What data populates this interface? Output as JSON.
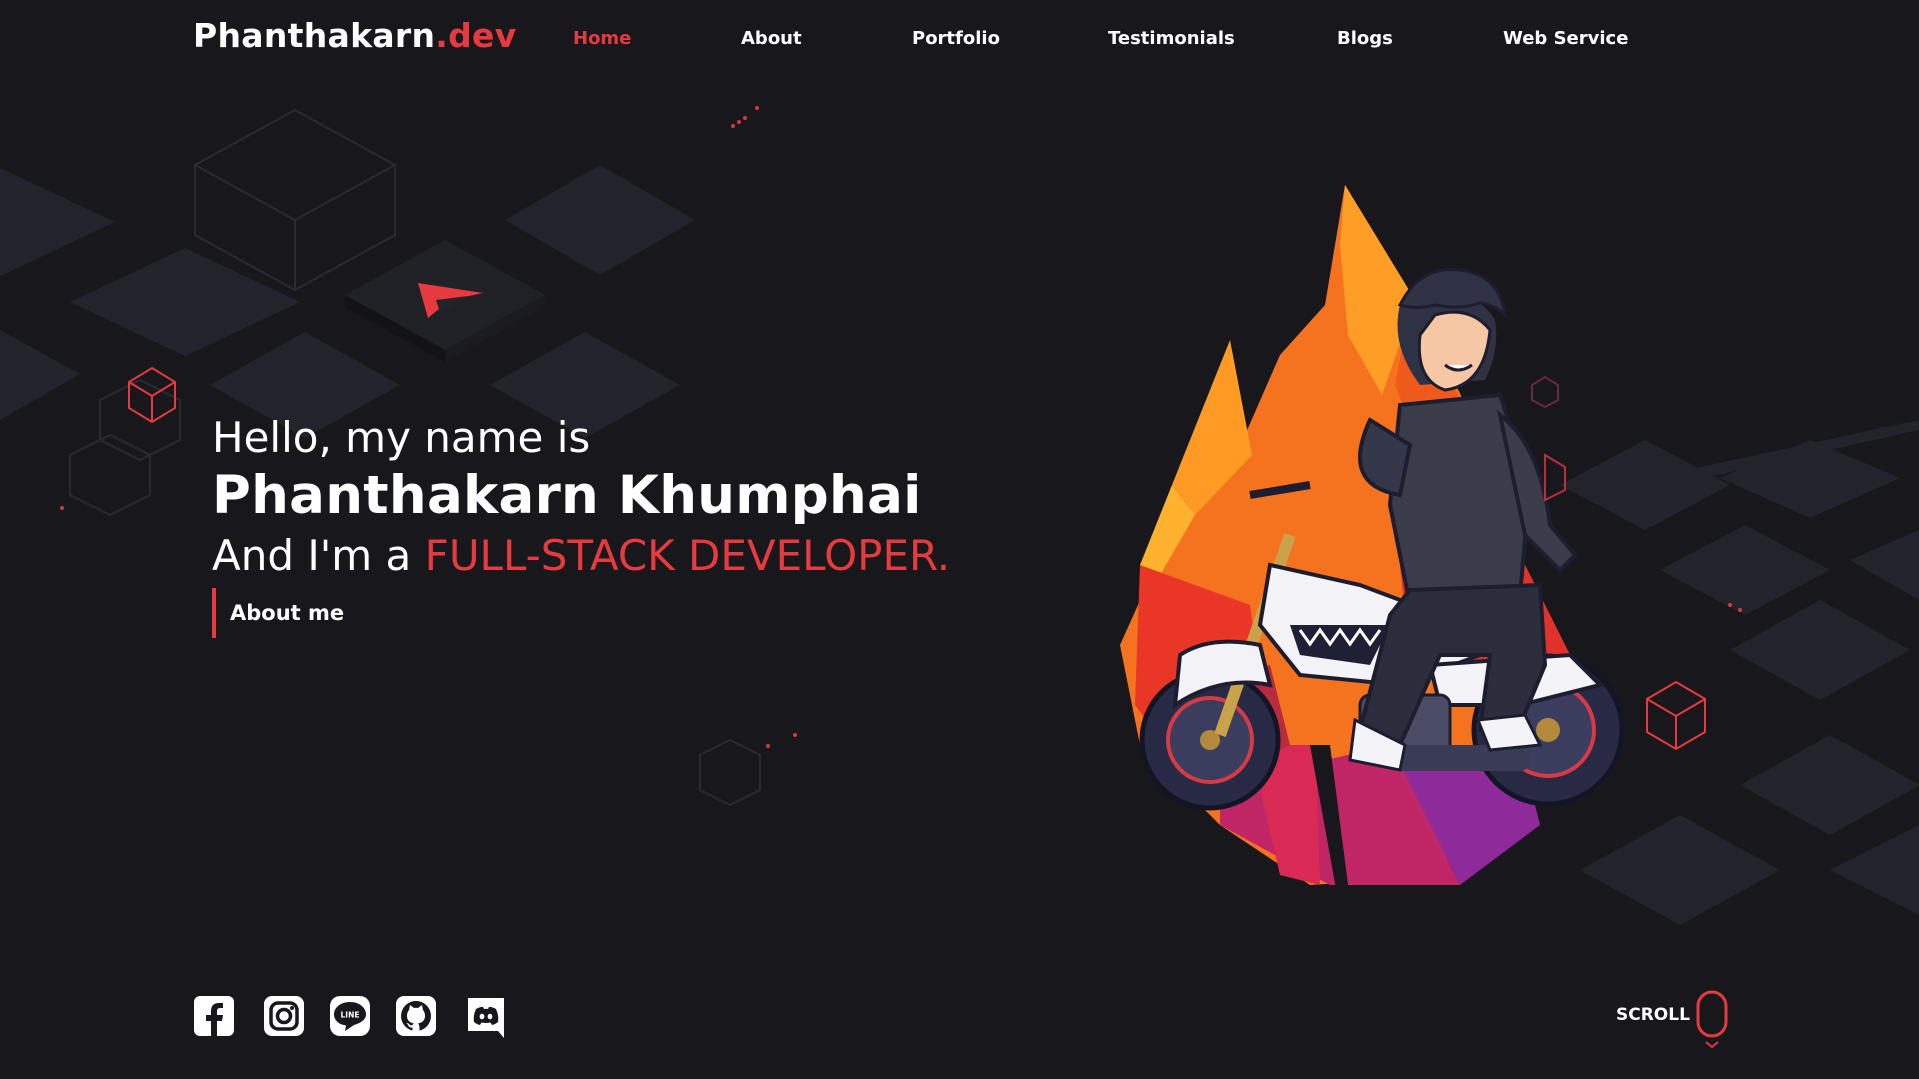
{
  "brand": {
    "name": "Phanthakarn",
    "tld": ".dev"
  },
  "nav": {
    "items": [
      {
        "label": "Home",
        "active": true
      },
      {
        "label": "About"
      },
      {
        "label": "Portfolio"
      },
      {
        "label": "Testimonials"
      },
      {
        "label": "Blogs"
      },
      {
        "label": "Web Service"
      }
    ]
  },
  "hero": {
    "greeting": "Hello, my name is",
    "name": "Phanthakarn Khumphai",
    "role_prefix": "And I'm a ",
    "role": "FULL-STACK DEVELOPER.",
    "about_link": "About me"
  },
  "social": {
    "icons": [
      "facebook-icon",
      "instagram-icon",
      "line-icon",
      "github-icon",
      "discord-icon"
    ],
    "line_text": "LINE"
  },
  "scroll": {
    "label": "SCROLL"
  },
  "colors": {
    "background": "#18171c",
    "accent": "#e63a3e",
    "tile": "#23232b"
  }
}
